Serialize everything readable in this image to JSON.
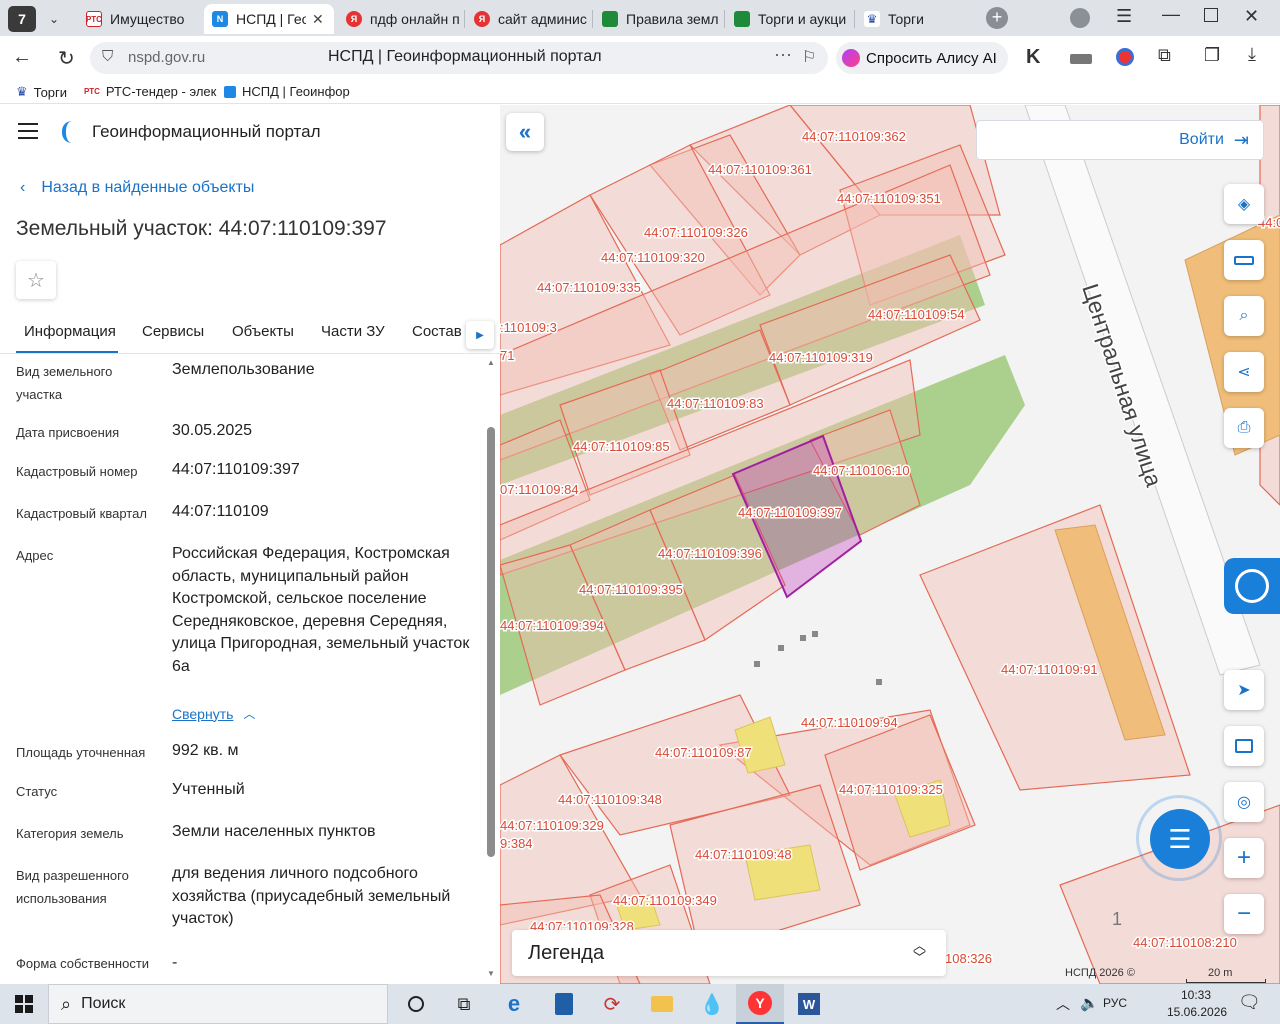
{
  "browser": {
    "counter_badge": "7",
    "tabs": [
      {
        "label": "Имущество",
        "favicon": "РТС"
      },
      {
        "label": "НСПД | Гео",
        "favicon": "N"
      },
      {
        "label": "пдф онлайн п",
        "favicon": "Я"
      },
      {
        "label": "сайт админис",
        "favicon": "Я"
      },
      {
        "label": "Правила земл",
        "favicon": ""
      },
      {
        "label": "Торги и аукци",
        "favicon": ""
      },
      {
        "label": "Торги",
        "favicon": ""
      }
    ],
    "url_domain": "nspd.gov.ru",
    "page_title": "НСПД | Геоинформационный портал",
    "alice_label": "Спросить Алису AI",
    "bookmarks": [
      {
        "label": "Торги"
      },
      {
        "label": "РТС-тендер - элек"
      },
      {
        "label": "НСПД | Геоинфор"
      }
    ]
  },
  "panel": {
    "app_title": "Геоинформационный портал",
    "back_link": "Назад в найденные объекты",
    "object_title": "Земельный участок: 44:07:110109:397",
    "tabs": [
      "Информация",
      "Сервисы",
      "Объекты",
      "Части ЗУ",
      "Состав"
    ],
    "fields": [
      {
        "label": "Вид земельного участка",
        "value": "Землепользование"
      },
      {
        "label": "Дата присвоения",
        "value": "30.05.2025"
      },
      {
        "label": "Кадастровый номер",
        "value": "44:07:110109:397"
      },
      {
        "label": "Кадастровый квартал",
        "value": "44:07:110109"
      },
      {
        "label": "Адрес",
        "value": "Российская Федерация, Костромская область, муниципальный район Костромской, сельское поселение Середняковское, деревня Середняя, улица Пригородная, земельный участок 6а"
      },
      {
        "label": "Площадь уточненная",
        "value": "992 кв. м"
      },
      {
        "label": "Статус",
        "value": "Учтенный"
      },
      {
        "label": "Категория земель",
        "value": "Земли населенных пунктов"
      },
      {
        "label": "Вид разрешенного использования",
        "value": "для ведения личного подсобного хозяйства (приусадебный земельный участок)"
      },
      {
        "label": "Форма собственности",
        "value": "-"
      }
    ],
    "collapse_link": "Свернуть"
  },
  "map": {
    "login_label": "Войти",
    "legend_label": "Легенда",
    "street_label": "Центральная улица",
    "copyright": "НСПД 2026 ©",
    "scale_label": "20 m",
    "house_number": "1",
    "parcel_labels": [
      "44:07:110109:362",
      "44:07:110109:361",
      "44:07:110109:351",
      "44:07:110109:326",
      "44:07:110109:320",
      "44:07:110109:335",
      "44:07:110109:54",
      "44:07:110109:319",
      "44:07:110109:83",
      "44:07:110109:85",
      "44:07:110106:10",
      "44:07:110109:397",
      "44:07:110109:396",
      "44:07:110109:395",
      "44:07:110109:394",
      "44:07:110109:91",
      "44:07:110109:94",
      "44:07:110109:87",
      "44:07:110109:348",
      "44:07:110109:325",
      "44:07:110109:329",
      "44:07:110109:48",
      "44:07:110109:349",
      "44:07:110109:328",
      "44:07:110108:210",
      "108:326",
      ":110109:3",
      "71",
      "07:110109:84",
      "9:384",
      "44:0",
      "1"
    ]
  },
  "taskbar": {
    "search_label": "Поиск",
    "lang": "РУС",
    "time": "10:33",
    "date": "15.06.2026"
  }
}
